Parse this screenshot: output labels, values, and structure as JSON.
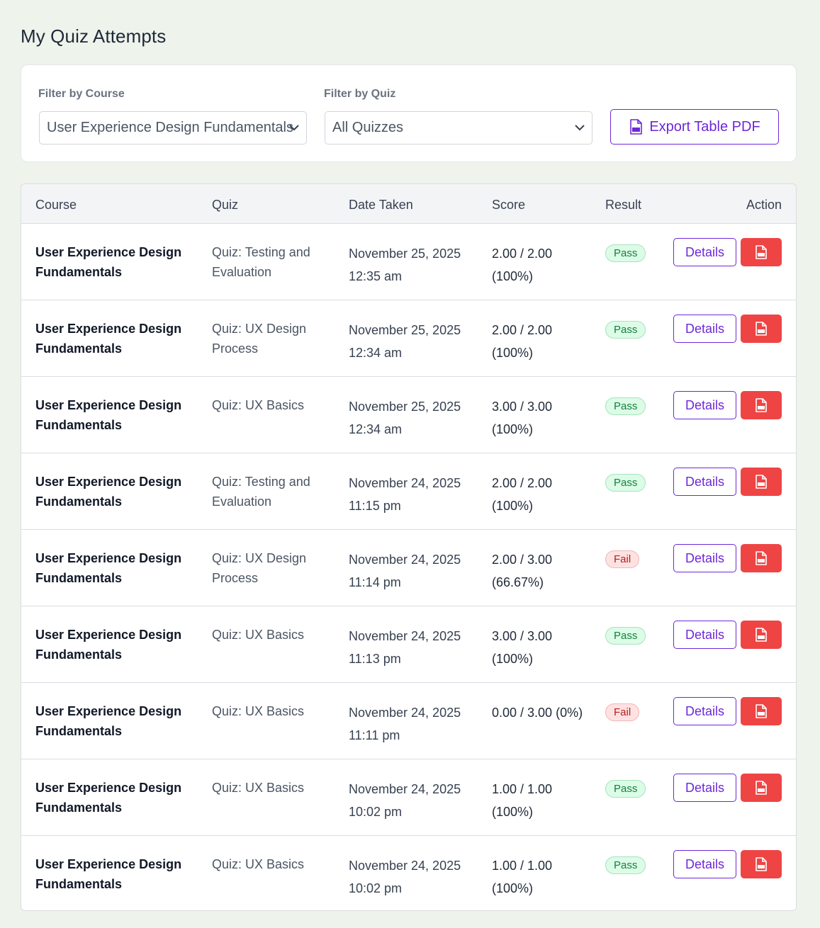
{
  "page": {
    "title": "My Quiz Attempts"
  },
  "filters": {
    "course_label": "Filter by Course",
    "course_value": "User Experience Design Fundamentals",
    "quiz_label": "Filter by Quiz",
    "quiz_value": "All Quizzes",
    "export_label": "Export Table PDF"
  },
  "colors": {
    "accent": "#6d28d9",
    "pdf_button": "#ef4444",
    "pass": "#15803d",
    "fail": "#b91c1c"
  },
  "table": {
    "headers": {
      "course": "Course",
      "quiz": "Quiz",
      "date": "Date Taken",
      "score": "Score",
      "result": "Result",
      "action": "Action"
    },
    "details_label": "Details",
    "rows": [
      {
        "course": "User Experience Design Fundamentals",
        "quiz": "Quiz: Testing and Evaluation",
        "date": "November 25, 2025 12:35 am",
        "score": "2.00 / 2.00 (100%)",
        "result": "Pass"
      },
      {
        "course": "User Experience Design Fundamentals",
        "quiz": "Quiz: UX Design Process",
        "date": "November 25, 2025 12:34 am",
        "score": "2.00 / 2.00 (100%)",
        "result": "Pass"
      },
      {
        "course": "User Experience Design Fundamentals",
        "quiz": "Quiz: UX Basics",
        "date": "November 25, 2025 12:34 am",
        "score": "3.00 / 3.00 (100%)",
        "result": "Pass"
      },
      {
        "course": "User Experience Design Fundamentals",
        "quiz": "Quiz: Testing and Evaluation",
        "date": "November 24, 2025 11:15 pm",
        "score": "2.00 / 2.00 (100%)",
        "result": "Pass"
      },
      {
        "course": "User Experience Design Fundamentals",
        "quiz": "Quiz: UX Design Process",
        "date": "November 24, 2025 11:14 pm",
        "score": "2.00 / 3.00 (66.67%)",
        "result": "Fail"
      },
      {
        "course": "User Experience Design Fundamentals",
        "quiz": "Quiz: UX Basics",
        "date": "November 24, 2025 11:13 pm",
        "score": "3.00 / 3.00 (100%)",
        "result": "Pass"
      },
      {
        "course": "User Experience Design Fundamentals",
        "quiz": "Quiz: UX Basics",
        "date": "November 24, 2025 11:11 pm",
        "score": "0.00 / 3.00 (0%)",
        "result": "Fail"
      },
      {
        "course": "User Experience Design Fundamentals",
        "quiz": "Quiz: UX Basics",
        "date": "November 24, 2025 10:02 pm",
        "score": "1.00 / 1.00 (100%)",
        "result": "Pass"
      },
      {
        "course": "User Experience Design Fundamentals",
        "quiz": "Quiz: UX Basics",
        "date": "November 24, 2025 10:02 pm",
        "score": "1.00 / 1.00 (100%)",
        "result": "Pass"
      }
    ]
  }
}
